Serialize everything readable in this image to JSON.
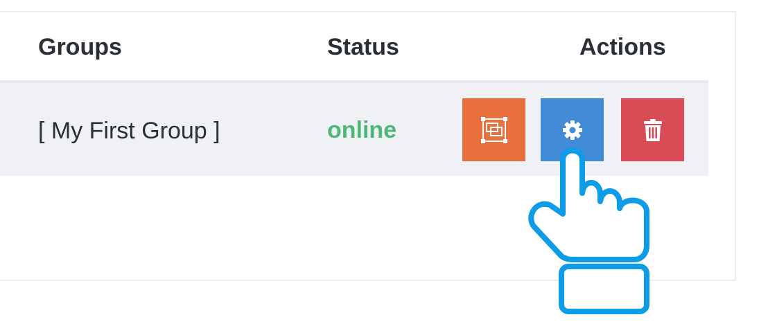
{
  "table": {
    "columns": [
      "Groups",
      "Status",
      "Actions"
    ],
    "rows": [
      {
        "group": "[ My First Group ]",
        "status": "online",
        "actions": [
          {
            "name": "copy",
            "icon": "copy-window-icon",
            "color": "#e8703e"
          },
          {
            "name": "settings",
            "icon": "gear-icon",
            "color": "#428bd7"
          },
          {
            "name": "delete",
            "icon": "trash-icon",
            "color": "#d94c55"
          }
        ]
      }
    ]
  },
  "colors": {
    "status_online": "#4cb877",
    "row_background": "#f0f1f5",
    "cursor_stroke": "#0d9ce8"
  },
  "cursor": {
    "icon": "hand-pointer-icon"
  }
}
